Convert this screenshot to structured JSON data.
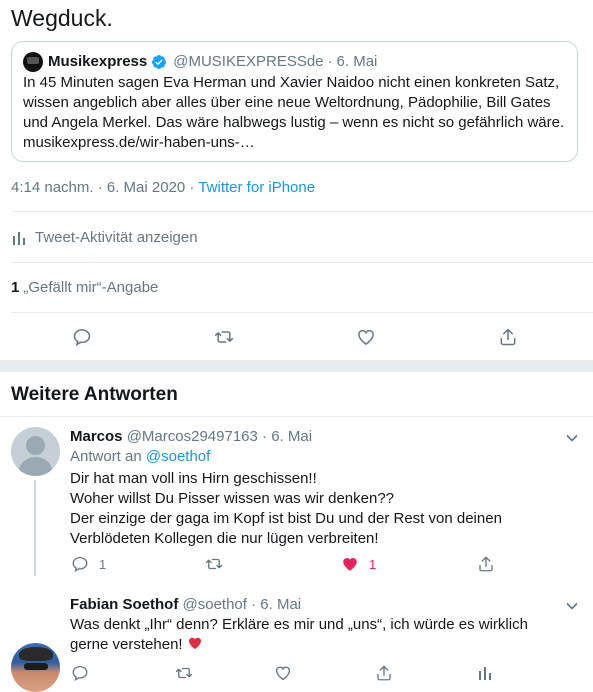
{
  "tweet": {
    "text": "Wegduck.",
    "quote": {
      "name": "Musikexpress",
      "handle": "@MUSIKEXPRESSde",
      "sep": "·",
      "date": "6. Mai",
      "body": "In 45 Minuten sagen Eva Herman und Xavier Naidoo nicht einen konkreten Satz, wissen angeblich aber alles über eine neue Weltordnung, Pädophilie, Bill Gates und Angela Merkel. Das wäre halbwegs lustig – wenn es nicht so gefährlich wäre. musikexpress.de/wir-haben-uns-…"
    },
    "timestamp": "4:14 nachm. · 6. Mai 2020 ·",
    "source": "Twitter for iPhone",
    "activity_label": "Tweet-Aktivität anzeigen",
    "likes_count": "1",
    "likes_label": "„Gefällt mir“-Angabe"
  },
  "section": {
    "title": "Weitere Antworten"
  },
  "replies": [
    {
      "name": "Marcos",
      "handle": "@Marcos29497163",
      "sep": "·",
      "date": "6. Mai",
      "reply_to_prefix": "Antwort an",
      "reply_to_handle": "@soethof",
      "lines": [
        "Dir hat man voll ins Hirn geschissen!!",
        "Woher willst Du Pisser wissen was wir denken??",
        "Der einzige der gaga im Kopf ist bist Du und der Rest von deinen",
        "Verblödeten Kollegen die nur lügen verbreiten!"
      ],
      "reply_count": "1",
      "like_count": "1"
    },
    {
      "name": "Fabian Soethof",
      "handle": "@soethof",
      "sep": "·",
      "date": "6. Mai",
      "lines": [
        "Was denkt „Ihr“ denn? Erkläre es mir und „uns“, ich würde es wirklich",
        "gerne verstehen!"
      ]
    }
  ],
  "colors": {
    "link": "#1b95e0",
    "secondary": "#657786",
    "like_red": "#e0245e",
    "divider": "#e6ecf0"
  },
  "icons": [
    "verified-badge-icon",
    "reply-icon",
    "retweet-icon",
    "like-icon",
    "share-icon",
    "analytics-icon",
    "chevron-down-icon",
    "heart-emoji-icon"
  ]
}
